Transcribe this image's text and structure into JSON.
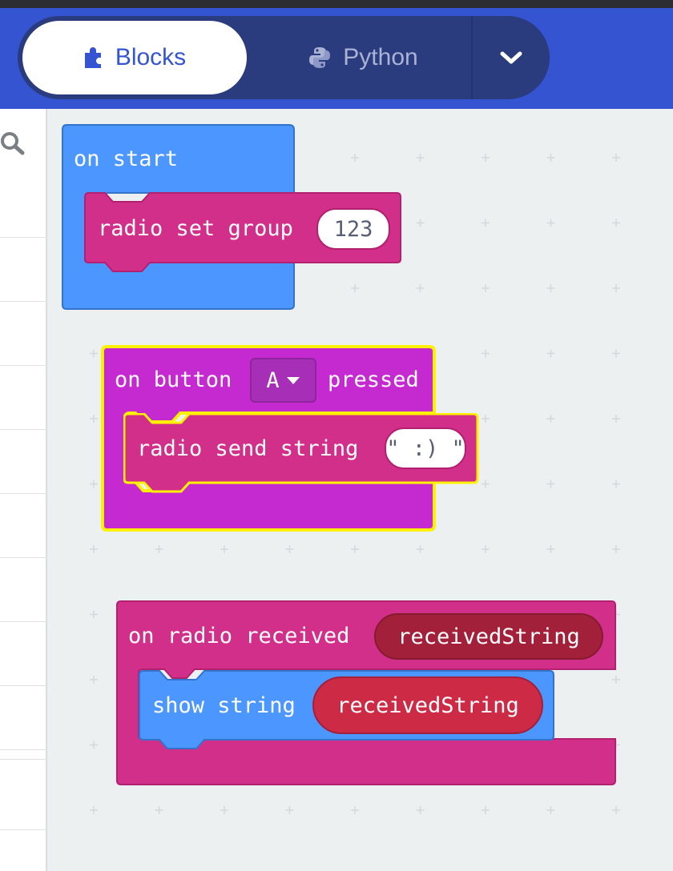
{
  "header": {
    "tabs": [
      {
        "label": "Blocks",
        "icon": "puzzle-icon",
        "active": true
      },
      {
        "label": "Python",
        "icon": "python-icon",
        "active": false
      }
    ],
    "dropdown_icon": "chevron-down-icon"
  },
  "sidebar": {
    "search_icon": "search-icon"
  },
  "workspace": {
    "blocks": {
      "on_start": {
        "label": "on start",
        "color": "#4c97ff",
        "child": {
          "label": "radio set group",
          "value": "123",
          "color": "#d22f8a"
        }
      },
      "on_button": {
        "label_before": "on button",
        "button_option": "A",
        "label_after": "pressed",
        "color": "#c52ad1",
        "selected_outline": "#fff200",
        "child": {
          "label": "radio send string",
          "value": "\" :) \"",
          "color": "#d22f8a"
        }
      },
      "on_radio_received": {
        "label": "on radio received",
        "param": "receivedString",
        "color": "#d22f8a",
        "param_color": "#a3203a",
        "child": {
          "label": "show string",
          "value": "receivedString",
          "color": "#4c97ff",
          "value_color": "#cc2a45"
        }
      }
    }
  }
}
